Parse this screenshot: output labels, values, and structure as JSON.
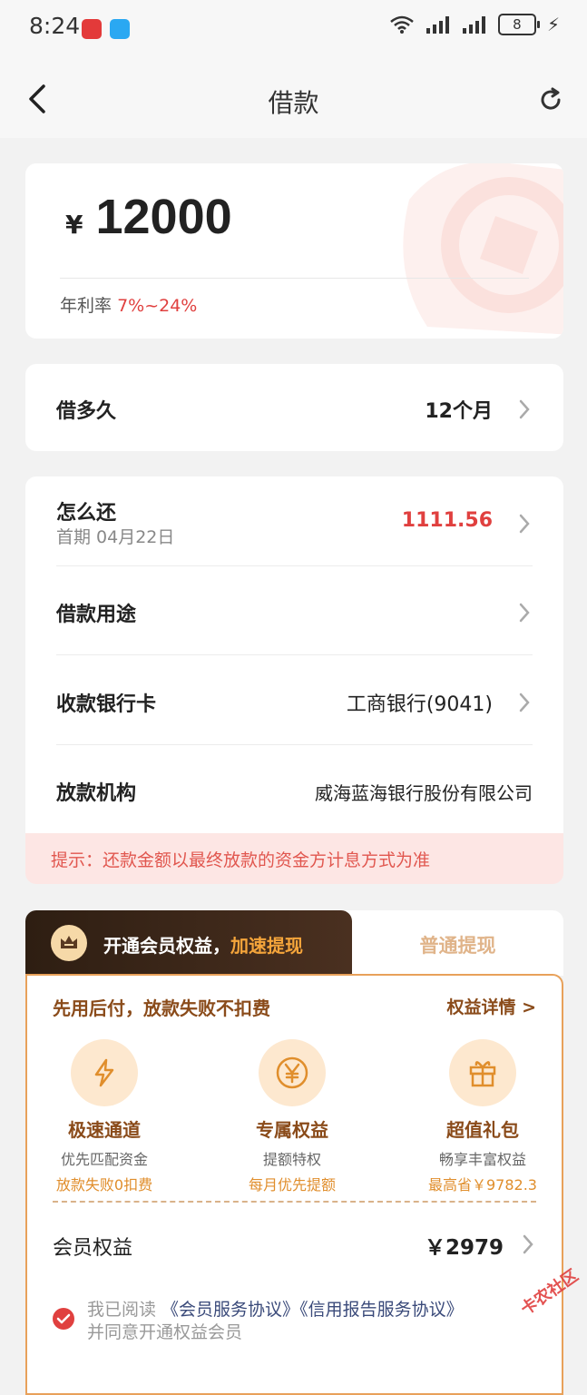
{
  "status_bar": {
    "time": "8:24",
    "network_sup": "6",
    "battery": "8",
    "app_icons": [
      "news-app-icon",
      "message-app-icon"
    ]
  },
  "nav": {
    "title": "借款"
  },
  "amount": {
    "currency": "¥",
    "value": "12000",
    "rate_label": "年利率",
    "rate_value": "7%~24%"
  },
  "term": {
    "label": "借多久",
    "value": "12个月"
  },
  "details": {
    "repay_label": "怎么还",
    "repay_sub": "首期 04月22日",
    "repay_value": "1111.56",
    "purpose_label": "借款用途",
    "card_label": "收款银行卡",
    "card_value": "工商银行(9041)",
    "org_label": "放款机构",
    "org_value": "威海蓝海银行股份有限公司"
  },
  "tip": "提示：还款金额以最终放款的资金方计息方式为准",
  "member": {
    "tab_active_prefix": "开通会员权益，",
    "tab_active_highlight": "加速提现",
    "tab_other": "普通提现",
    "head": "先用后付，放款失败不扣费",
    "head_link": "权益详情 >",
    "benefits": [
      {
        "title": "极速通道",
        "line1": "优先匹配资金",
        "line2": "放款失败0扣费"
      },
      {
        "title": "专属权益",
        "line1": "提额特权",
        "line2": "每月优先提额"
      },
      {
        "title": "超值礼包",
        "line1": "畅享丰富权益",
        "line2": "最高省￥9782.3"
      }
    ],
    "rights_label": "会员权益",
    "rights_value": "￥2979",
    "agree_prefix": "我已阅读 ",
    "agree_link1": "《会员服务协议》",
    "agree_link2": "《信用报告服务协议》",
    "agree_suffix": "并同意开通权益会员"
  },
  "watermark": "卡农社区",
  "colors": {
    "accent_red": "#e0403f",
    "member_brown": "#8a4b1a",
    "member_orange": "#f5a53b"
  }
}
